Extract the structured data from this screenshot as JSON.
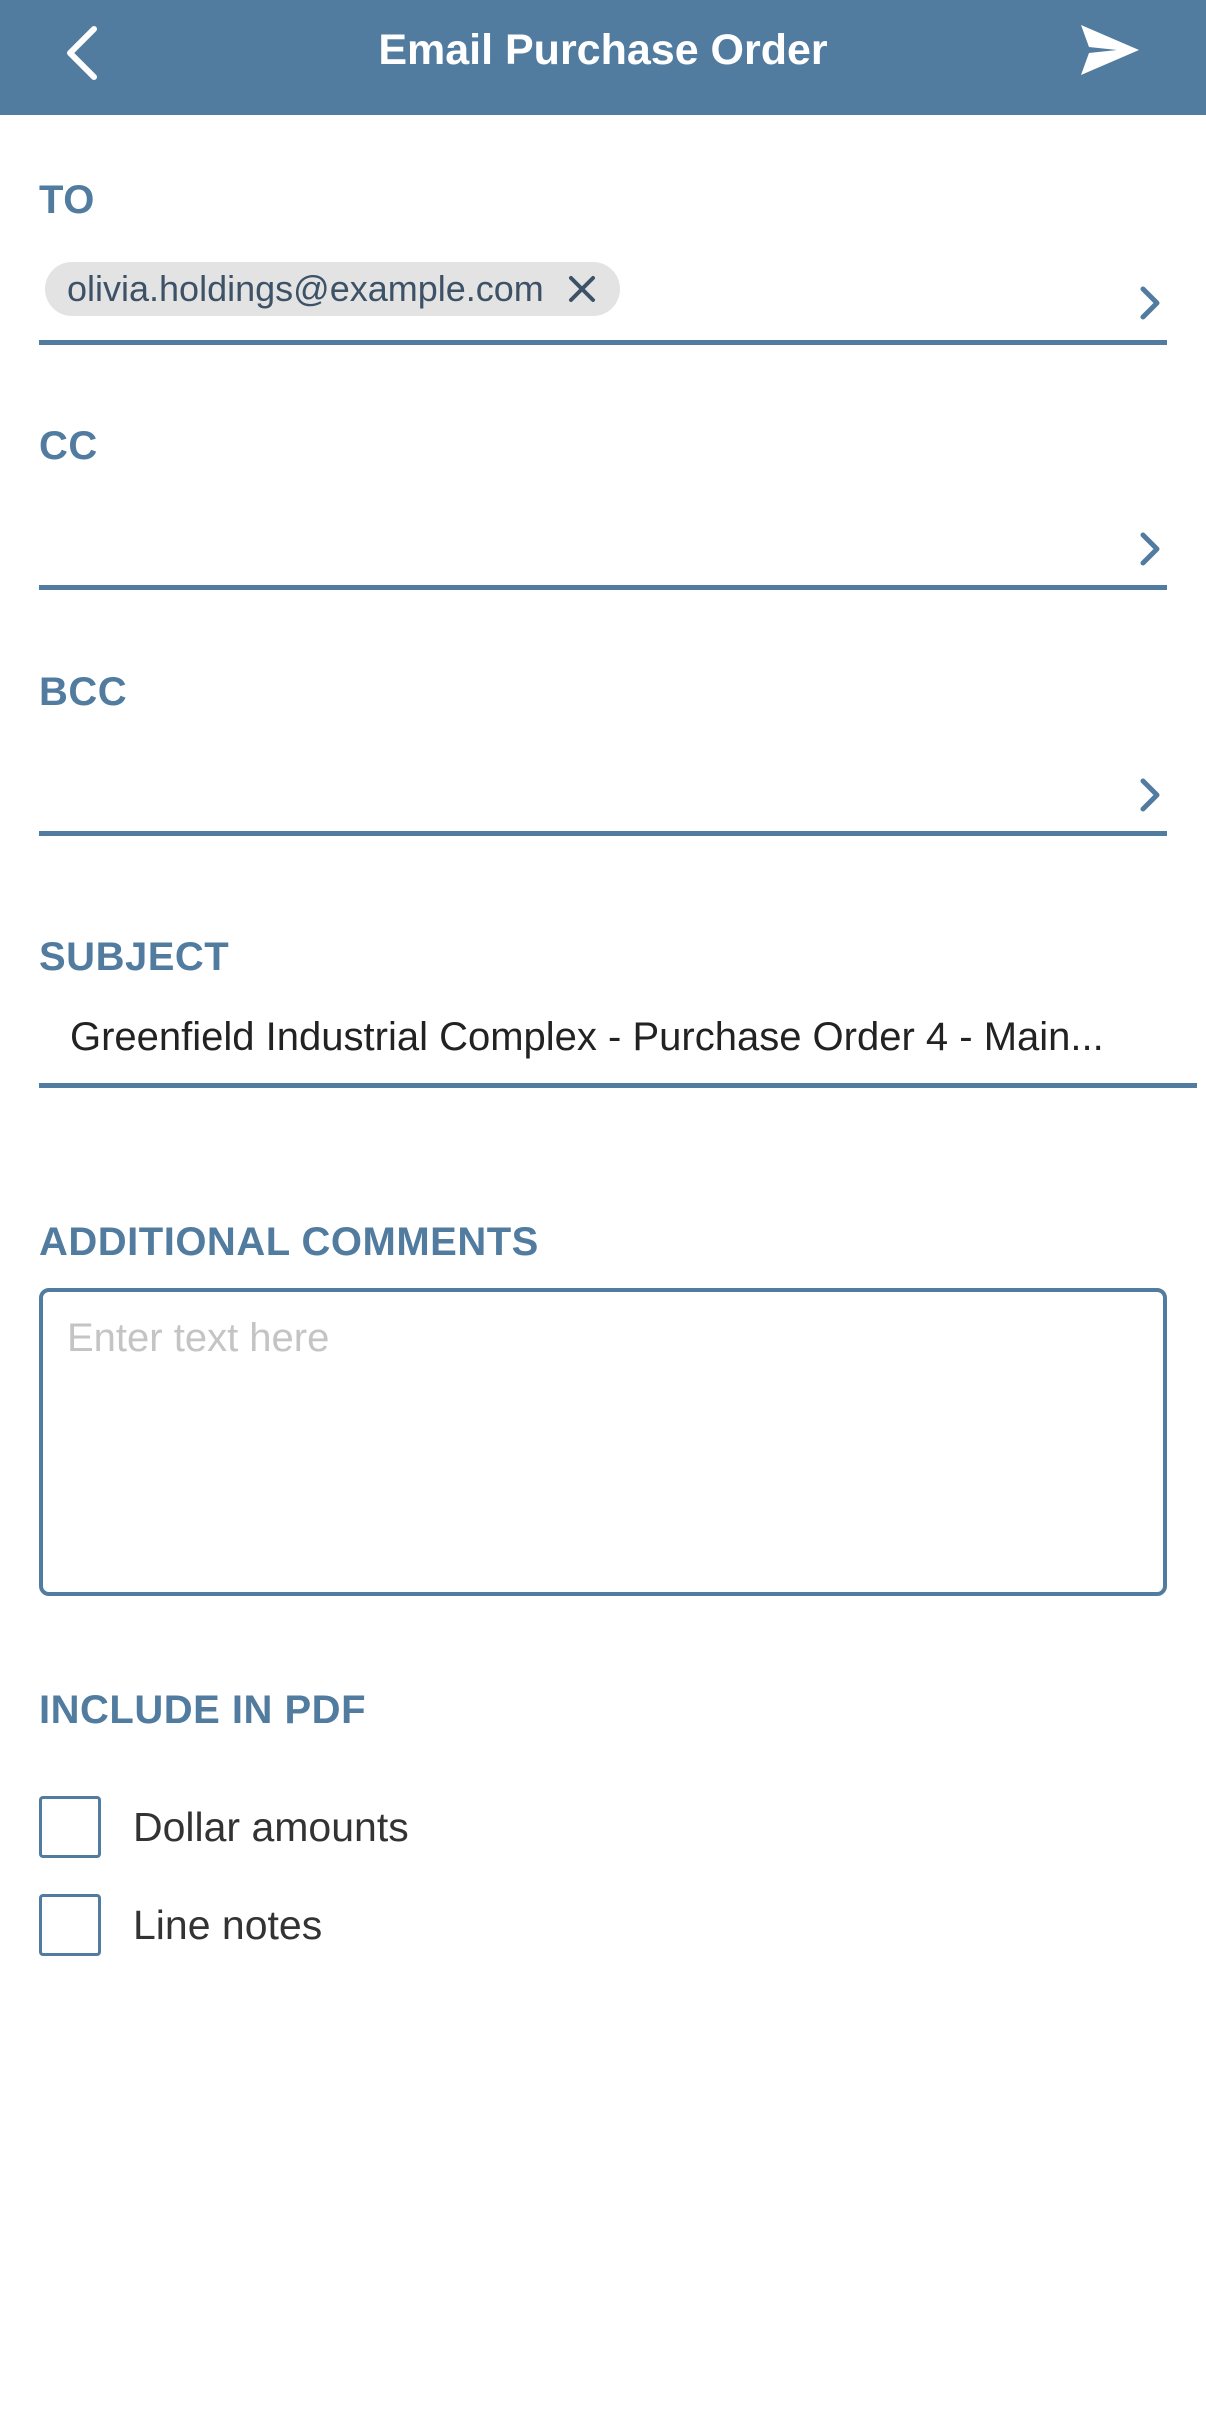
{
  "header": {
    "title": "Email Purchase Order",
    "back_icon": "chevron-left-icon",
    "send_icon": "send-icon"
  },
  "to": {
    "label": "TO",
    "recipients": [
      "olivia.holdings@example.com"
    ]
  },
  "cc": {
    "label": "CC"
  },
  "bcc": {
    "label": "BCC"
  },
  "subject": {
    "label": "SUBJECT",
    "value": "Greenfield Industrial Complex - Purchase Order 4 - Main..."
  },
  "comments": {
    "label": "ADDITIONAL COMMENTS",
    "placeholder": "Enter text here"
  },
  "pdf": {
    "label": "INCLUDE IN PDF",
    "options": [
      {
        "label": "Dollar amounts",
        "checked": false
      },
      {
        "label": "Line notes",
        "checked": false
      }
    ]
  },
  "colors": {
    "accent": "#527c9f",
    "chip_bg": "#e3e3e3",
    "text": "#333333",
    "placeholder": "#c4c4c4"
  }
}
